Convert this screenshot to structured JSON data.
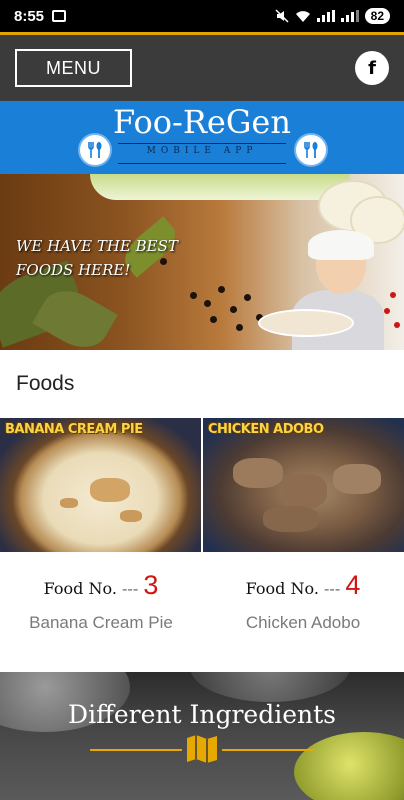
{
  "status_bar": {
    "time": "8:55",
    "battery": "82",
    "icons": [
      "screenshot-icon",
      "mute-icon",
      "wifi-icon",
      "signal-icon",
      "battery-icon"
    ]
  },
  "header": {
    "menu_label": "MENU",
    "facebook_icon": "f"
  },
  "brand": {
    "title": "Foo-ReGen",
    "subtitle": "MOBILE APP",
    "logo_icon": "fork-spoon-icon"
  },
  "hero": {
    "tagline": "WE HAVE THE BEST FOODS HERE!"
  },
  "foods": {
    "heading": "Foods",
    "number_prefix": "Food No.",
    "number_dash": "---",
    "items": [
      {
        "image_caption": "BANANA CREAM PIE",
        "number": "3",
        "name": "Banana Cream Pie"
      },
      {
        "image_caption": "CHICKEN ADOBO",
        "number": "4",
        "name": "Chicken Adobo"
      }
    ]
  },
  "ingredients": {
    "title": "Different Ingredients",
    "icon": "map-icon"
  },
  "colors": {
    "accent_gold": "#e0a400",
    "brand_blue": "#1a7fd6",
    "header_dark": "#3b3b3b",
    "number_red": "#d01515"
  }
}
